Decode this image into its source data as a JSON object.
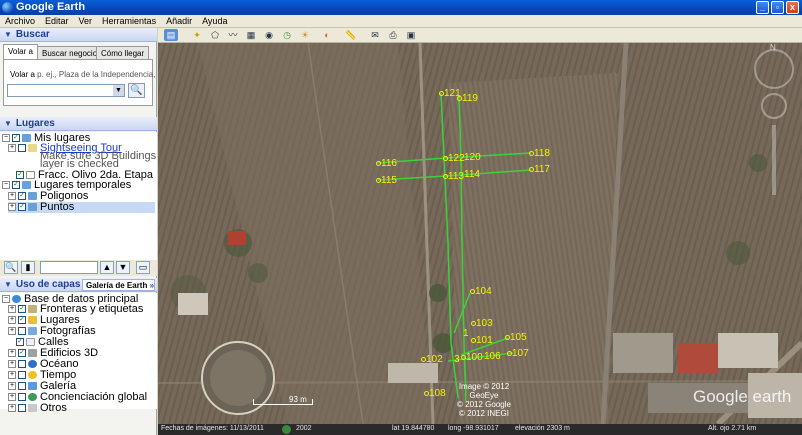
{
  "window": {
    "title": "Google Earth"
  },
  "menu": [
    "Archivo",
    "Editar",
    "Ver",
    "Herramientas",
    "Añadir",
    "Ayuda"
  ],
  "search": {
    "header": "Buscar",
    "tabs": [
      "Volar a",
      "Buscar negocios",
      "Cómo llegar"
    ],
    "fly_label": "Volar a",
    "fly_hint": "p. ej., Plaza de la Independencia, Monte",
    "input_value": ""
  },
  "places": {
    "header": "Lugares",
    "items": [
      {
        "label": "Mis lugares"
      },
      {
        "label": "Sightseeing Tour"
      },
      {
        "label": "Make sure 3D Buildings"
      },
      {
        "label": "layer is checked"
      },
      {
        "label": "Fracc. Olivo 2da. Etapa"
      },
      {
        "label": "Lugares temporales"
      },
      {
        "label": "Poligonos"
      },
      {
        "label": "Puntos"
      }
    ]
  },
  "layers": {
    "header": "Uso de capas",
    "gallery_button": "Galería de Earth",
    "gallery_arrow": "»",
    "items": [
      {
        "label": "Base de datos principal"
      },
      {
        "label": "Fronteras y etiquetas"
      },
      {
        "label": "Lugares"
      },
      {
        "label": "Fotografías"
      },
      {
        "label": "Calles"
      },
      {
        "label": "Edificios 3D"
      },
      {
        "label": "Océano"
      },
      {
        "label": "Tiempo"
      },
      {
        "label": "Galería"
      },
      {
        "label": "Concienciación global"
      },
      {
        "label": "Otros"
      }
    ]
  },
  "map": {
    "points": [
      "121",
      "119",
      "116",
      "122",
      "120",
      "118",
      "115",
      "113",
      "114",
      "117",
      "104",
      "103",
      "105",
      "101",
      "107",
      "102",
      "3",
      "100",
      "106",
      "108",
      "1"
    ],
    "scale_label": "93 m",
    "attribution": [
      "Image © 2012 GeoEye",
      "© 2012 Google",
      "© 2012 INEGI"
    ],
    "brand": "Google earth",
    "colors": {
      "track": "#3cd23c",
      "label": "#f5f500"
    }
  },
  "status": {
    "imagery_date": "Fechas de imágenes: 11/13/2011",
    "year": "2002",
    "lat": "lat  19.844780",
    "lon": "long -98.931017",
    "elevation": "elevación  2303 m",
    "eye_alt": "Alt. ojo   2.71 km"
  }
}
